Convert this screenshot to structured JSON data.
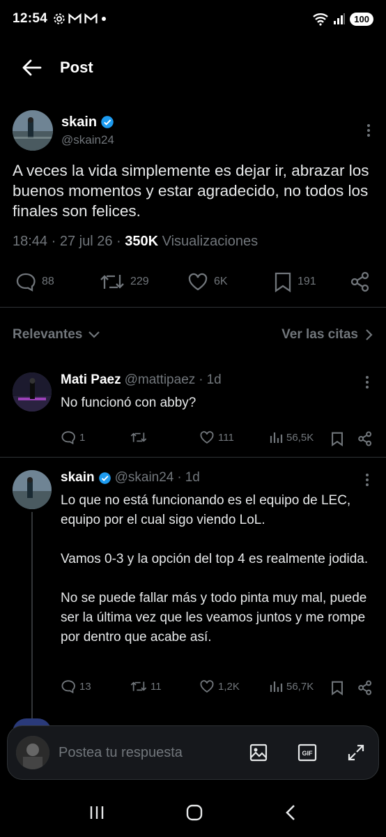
{
  "status_bar": {
    "time": "12:54",
    "battery": "100"
  },
  "header": {
    "title": "Post"
  },
  "post": {
    "name": "skain",
    "handle": "@skain24",
    "text": "A veces la vida simplemente es dejar ir, abrazar los buenos momentos y estar agradecido, no todos los finales son felices.",
    "time": "18:44",
    "date": "27 jul 26",
    "views_count": "350K",
    "views_label": "Visualizaciones",
    "replies": "88",
    "reposts": "229",
    "likes": "6K",
    "bookmarks": "191"
  },
  "sort": {
    "relevance_label": "Relevantes",
    "quotes_label": "Ver las citas"
  },
  "replies": [
    {
      "name": "Mati Paez",
      "handle": "@mattipaez",
      "time": "1d",
      "text": "No funcionó con abby?",
      "replies": "1",
      "reposts": "",
      "likes": "111",
      "views": "56,5K"
    },
    {
      "name": "skain",
      "handle": "@skain24",
      "time": "1d",
      "paragraphs": [
        "Lo que no está funcionando es el equipo de LEC, equipo por el cual sigo viendo LoL.",
        "Vamos 0-3 y la opción del top 4 es realmente jodida.",
        "No se puede fallar más y todo pinta muy mal, puede ser la última vez que les veamos juntos y me rompe por dentro que acabe así."
      ],
      "replies": "13",
      "reposts": "11",
      "likes": "1,2K",
      "views": "56,7K"
    }
  ],
  "compose": {
    "placeholder": "Postea tu respuesta"
  },
  "colors": {
    "background": "#000000",
    "verified": "#1d9bf0",
    "muted": "#71767b"
  }
}
